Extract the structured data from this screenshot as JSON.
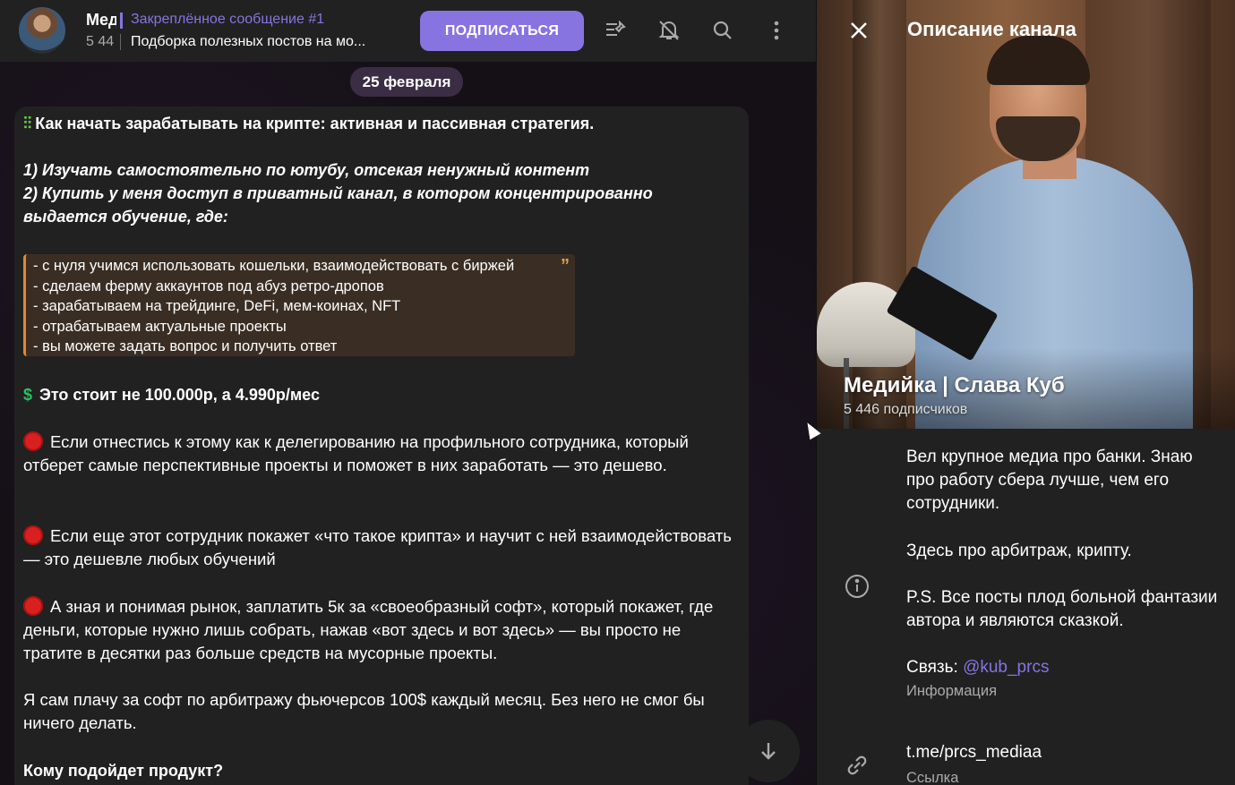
{
  "header": {
    "channel_title": "Медийка | Слава Куб",
    "subscribers_short": "5 44",
    "pinned_title": "Закреплённое сообщение #1",
    "pinned_text": "Подборка полезных постов на мо...",
    "subscribe_label": "ПОДПИСАТЬСЯ"
  },
  "date_label": "25 февраля",
  "message": {
    "headline": "Как начать зарабатывать на крипте: активная и пассивная стратегия.",
    "step1": "1) Изучать самостоятельно по ютубу, отсекая ненужный контент",
    "step2": "2) Купить у меня доступ в приватный канал, в котором концентрированно выдается обучение, где:",
    "quote_lines": [
      "- с нуля учимся использовать кошельки, взаимодействовать с биржей",
      "- сделаем ферму аккаунтов под абуз ретро-дропов",
      "- зарабатываем на трейдинге, DeFi, мем-коинах, NFT",
      "- отрабатываем актуальные проекты",
      "- вы можете задать вопрос и получить ответ"
    ],
    "price": "Это стоит не 100.000р, а 4.990р/мес",
    "para1": "Если отнестись к этому как к делегированию на профильного сотрудника, который отберет самые перспективные проекты и поможет в них заработать — это дешево.",
    "para2": "Если еще этот сотрудник покажет «что такое крипта» и научит с ней взаимодействовать — это дешевле любых обучений",
    "para3": "А зная и понимая рынок, заплатить 5к за «своеобразный софт», который покажет, где деньги, которые нужно лишь собрать, нажав «вот здесь и вот здесь» — вы просто не тратите в десятки раз больше средств на мусорные проекты.",
    "para4": "Я сам плачу за софт по арбитражу фьючерсов 100$ каждый месяц. Без него не смог бы ничего делать.",
    "para5": "Кому подойдет продукт?"
  },
  "panel": {
    "title": "Описание канала",
    "name": "Медийка | Слава Куб",
    "subscribers": "5 446 подписчиков",
    "desc_1": "Вел крупное медиа про банки. Знаю про работу сбера лучше, чем его сотрудники.",
    "desc_2": "Здесь про арбитраж, крипту.",
    "desc_3": "P.S. Все посты плод больной фантазии автора и являются сказкой.",
    "contact_prefix": "Связь: ",
    "contact_handle": "@kub_prcs",
    "info_label": "Информация",
    "link_value": "t.me/prcs_mediaa",
    "link_label": "Ссылка"
  },
  "colors": {
    "accent": "#8774e1",
    "quote_border": "#e08a2c",
    "panel_bg": "#212121"
  }
}
